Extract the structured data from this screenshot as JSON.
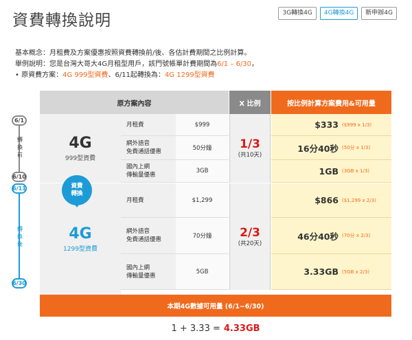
{
  "page": {
    "title": "資費轉換說明"
  },
  "tabs": [
    {
      "label": "3G轉換4G",
      "active": false
    },
    {
      "label": "4G轉換4G",
      "active": true
    },
    {
      "label": "新申辦4G",
      "active": false
    }
  ],
  "intro": {
    "line1": "基本概念：月租費及方案優惠按照資費轉換前/後、各估計費期間之比例計算。",
    "line2_prefix": "舉例說明：您是台灣大哥大4G月租型用戶，該門號帳單計費期間為",
    "line2_period": "6/1 – 6/30",
    "line2_suffix": "，",
    "line3_prefix": "• 原資費方案：",
    "line3_old": "4G 999型資費",
    "line3_mid": "、6/11起轉換為：",
    "line3_new": "4G 1299型資費"
  },
  "table": {
    "header_original": "原方案內容",
    "header_ratio": "X 比例",
    "header_calc": "按比例計算方案費用&可用量",
    "plan_before": {
      "name": "4G",
      "sub": "999型資費"
    },
    "plan_after": {
      "name": "4G",
      "sub": "1299型資費"
    },
    "switch_label_1": "資費",
    "switch_label_2": "轉換",
    "rows_before": [
      {
        "item": "月租費",
        "value": "$999",
        "amount": "$333",
        "note": "($999 x 1/3)"
      },
      {
        "item": "網外語音\n免費通話優惠",
        "value": "50分鐘",
        "amount": "16分40秒",
        "note": "(50分 x 1/3)"
      },
      {
        "item": "國內上網\n傳輸量優惠",
        "value": "3GB",
        "amount": "1GB",
        "note": "(3GB x 1/3)"
      }
    ],
    "rows_after": [
      {
        "item": "月租費",
        "value": "$1,299",
        "amount": "$866",
        "note": "($1,299 x 2/3)"
      },
      {
        "item": "網外語音\n免費通話優惠",
        "value": "70分鐘",
        "amount": "46分40秒",
        "note": "(70分 x 2/3)"
      },
      {
        "item": "國內上網\n傳輸量優惠",
        "value": "5GB",
        "amount": "3.33GB",
        "note": "(5GB x 2/3)"
      }
    ],
    "ratio_before": {
      "fraction": "1/3",
      "days": "(共10天)"
    },
    "ratio_after": {
      "fraction": "2/3",
      "days": "(共20天)"
    }
  },
  "timeline": {
    "d1": "6/1",
    "d2": "6/10",
    "d3": "6/11",
    "d4": "6/30",
    "before_label": "轉換前",
    "after_label": "轉換後"
  },
  "total": {
    "header": "本期4G數據可用量 (6/1~6/30)",
    "formula": "1 + 3.33 =",
    "result": "4.33GB"
  },
  "colors": {
    "orange": "#f06a1d",
    "blue": "#1d9bd6",
    "red": "#d81b1b",
    "cream": "#fff5cc"
  }
}
